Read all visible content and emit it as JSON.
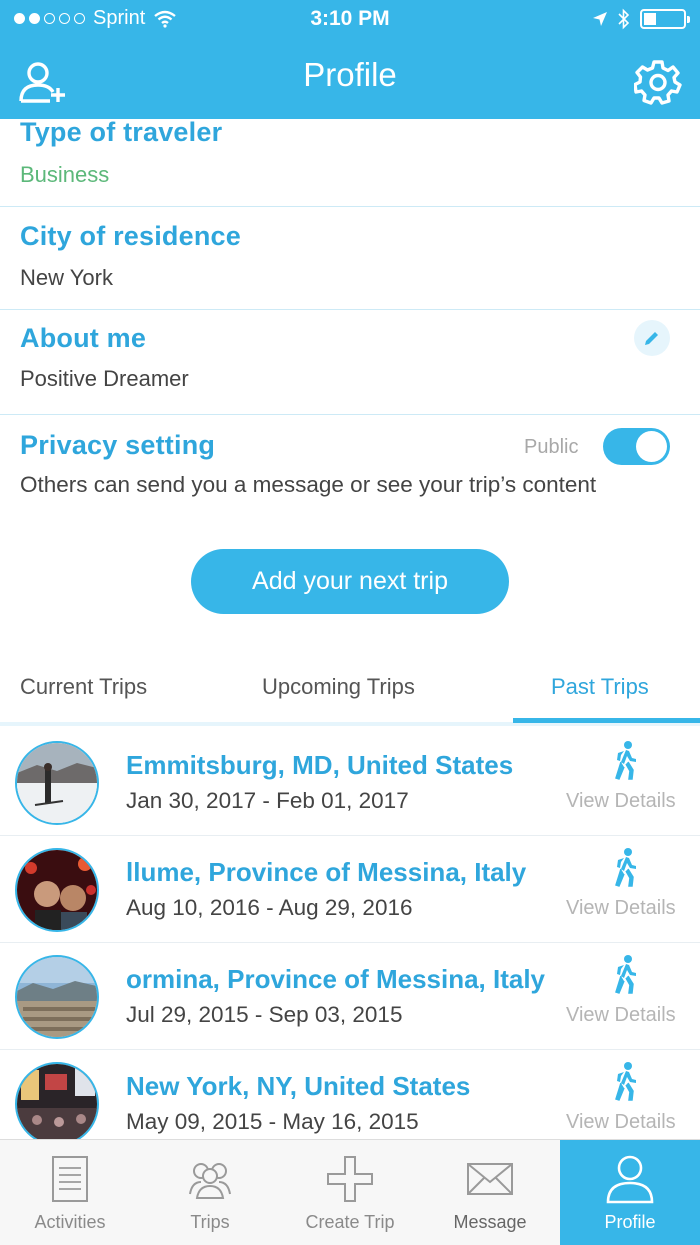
{
  "status_bar": {
    "carrier": "Sprint",
    "time": "3:10 PM"
  },
  "header": {
    "title": "Profile"
  },
  "profile": {
    "traveler_type": {
      "label": "Type of traveler",
      "value": "Business"
    },
    "city": {
      "label": "City of residence",
      "value": "New York"
    },
    "about": {
      "label": "About me",
      "value": "Positive Dreamer"
    },
    "privacy": {
      "label": "Privacy setting",
      "state_label": "Public",
      "enabled": true,
      "description": "Others can send you a message or see your trip’s content"
    }
  },
  "add_trip_label": "Add your next trip",
  "tabs": [
    {
      "label": "Current Trips",
      "active": false
    },
    {
      "label": "Upcoming Trips",
      "active": false
    },
    {
      "label": "Past Trips",
      "active": true
    }
  ],
  "trips": [
    {
      "destination": "Emmitsburg,  MD, United States",
      "dates": "Jan 30, 2017 - Feb 01, 2017",
      "action": "View Details"
    },
    {
      "destination": "llume,  Province of Messina, Italy",
      "dates": "Aug 10, 2016 - Aug 29, 2016",
      "action": "View Details"
    },
    {
      "destination": "ormina,  Province of Messina, Italy",
      "dates": "Jul 29, 2015 - Sep 03, 2015",
      "action": "View Details"
    },
    {
      "destination": "New York,  NY, United States",
      "dates": "May 09, 2015 - May 16, 2015",
      "action": "View Details"
    }
  ],
  "bottom_nav": [
    {
      "label": "Activities",
      "icon": "activities-icon"
    },
    {
      "label": "Trips",
      "icon": "trips-icon"
    },
    {
      "label": "Create Trip",
      "icon": "plus-icon"
    },
    {
      "label": "Message",
      "icon": "envelope-icon"
    },
    {
      "label": "Profile",
      "icon": "user-icon",
      "active": true
    }
  ],
  "colors": {
    "accent": "#37b6e8",
    "title_blue": "#2fa6dc",
    "green": "#5cb87a"
  }
}
